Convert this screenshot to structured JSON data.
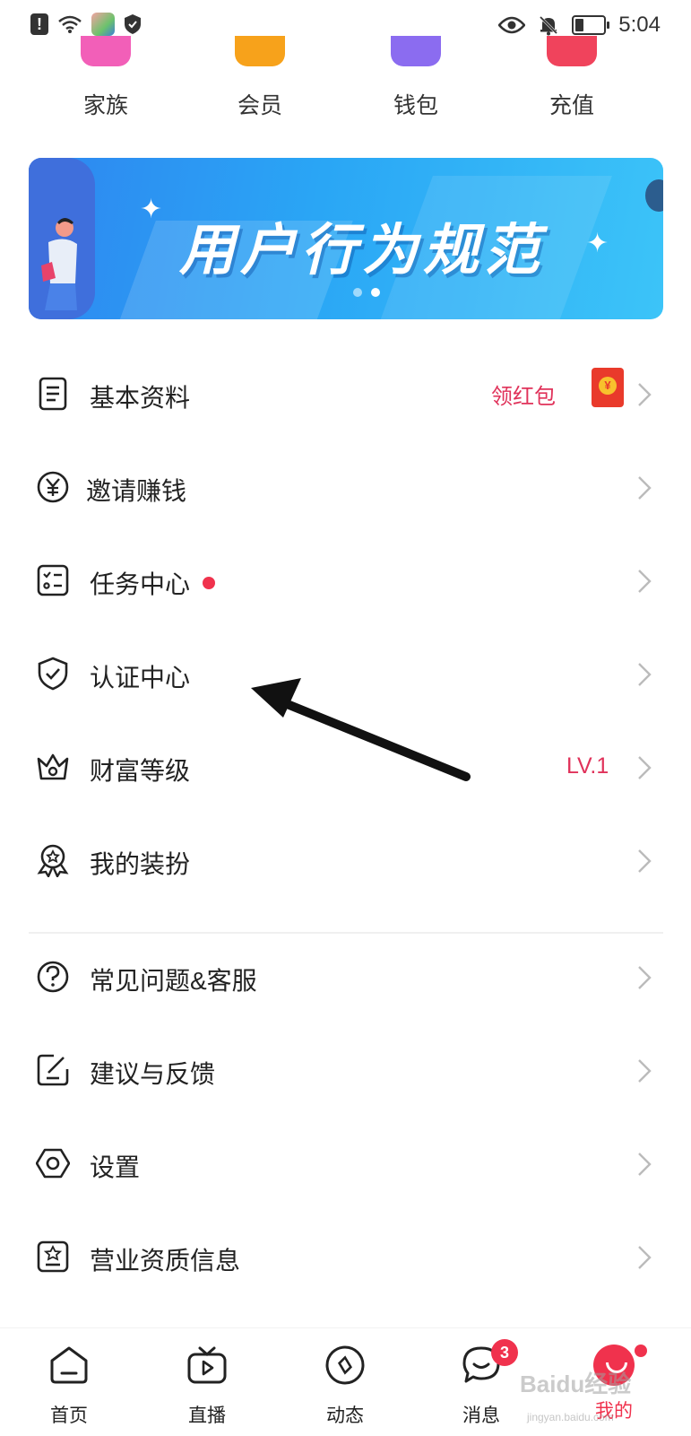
{
  "status_bar": {
    "time": "5:04",
    "icons": [
      "alert-icon",
      "wifi-icon",
      "app-notification-icon",
      "shield-icon",
      "eye-icon",
      "bell-off-icon",
      "battery-icon"
    ]
  },
  "quick_actions": [
    {
      "label": "家族",
      "color": "#f25fb8"
    },
    {
      "label": "会员",
      "color": "#f7a21b"
    },
    {
      "label": "钱包",
      "color": "#8b6cf0"
    },
    {
      "label": "充值",
      "color": "#f0435c"
    }
  ],
  "banner": {
    "title": "用户行为规范",
    "page_count": 2,
    "active_page": 2
  },
  "menu": {
    "basic_info": {
      "label": "基本资料",
      "extra": "领红包"
    },
    "invite": {
      "label": "邀请赚钱"
    },
    "tasks": {
      "label": "任务中心"
    },
    "verification": {
      "label": "认证中心"
    },
    "wealth_level": {
      "label": "财富等级",
      "extra": "LV.1"
    },
    "decoration": {
      "label": "我的装扮"
    },
    "faq": {
      "label": "常见问题&客服"
    },
    "feedback": {
      "label": "建议与反馈"
    },
    "settings": {
      "label": "设置"
    },
    "business_info": {
      "label": "营业资质信息"
    }
  },
  "bottom_nav": {
    "home": {
      "label": "首页"
    },
    "live": {
      "label": "直播"
    },
    "feed": {
      "label": "动态"
    },
    "messages": {
      "label": "消息",
      "badge": "3"
    },
    "me": {
      "label": "我的"
    }
  },
  "watermark": {
    "text": "Baidu经验",
    "sub": "jingyan.baidu.com"
  },
  "colors": {
    "accent": "#f0324d",
    "extra_text": "#e0325a",
    "banner_blue": "#2aa6f5"
  }
}
